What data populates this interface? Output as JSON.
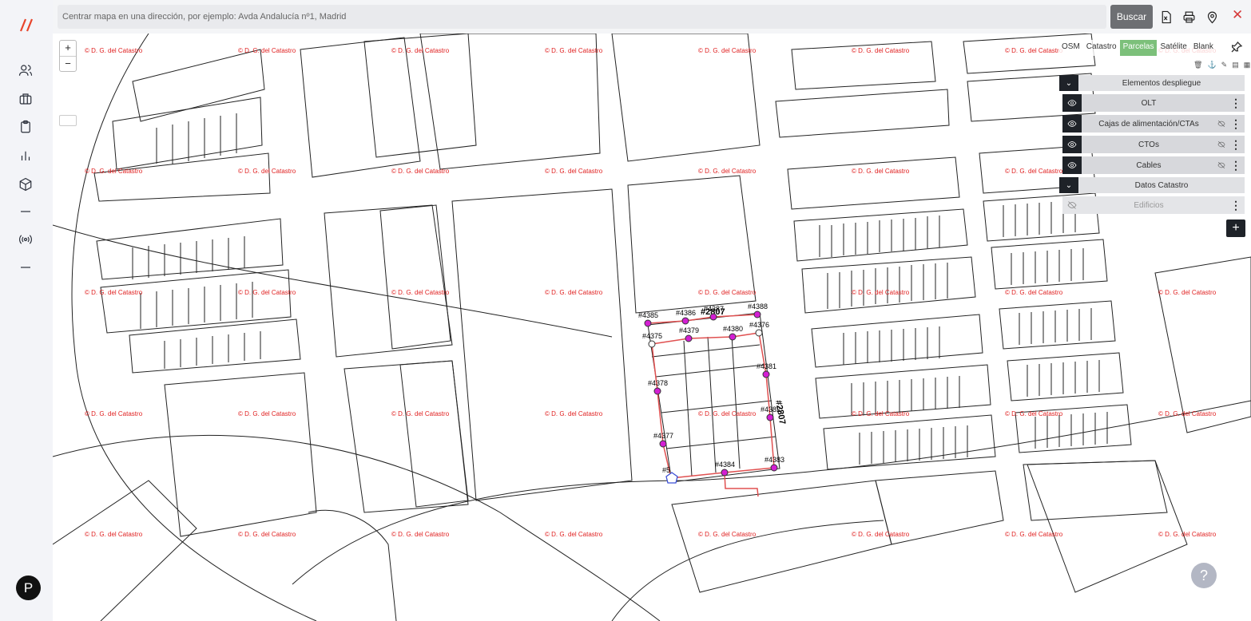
{
  "search": {
    "placeholder": "Centrar mapa en una dirección, por ejemplo: Avda Andalucía nº1, Madrid",
    "button": "Buscar"
  },
  "toolbar": {
    "close": "✕"
  },
  "sidebar": {
    "avatar_initial": "P"
  },
  "map": {
    "zoom_in": "+",
    "zoom_out": "−",
    "watermark": "© D. G. del Catastro",
    "basemaps": [
      "OSM",
      "Catastro",
      "Parcelas",
      "Satélite",
      "Blank"
    ],
    "active_basemap": "Parcelas",
    "nodes": [
      "#4385",
      "#4386",
      "#2807",
      "#4387",
      "#4388",
      "#4375",
      "#4379",
      "#4380",
      "#4376",
      "#4381",
      "#4378",
      "#2807",
      "#4382",
      "#4377",
      "#5",
      "#4384",
      "#4383"
    ],
    "route_color": "#e05050",
    "node_color": "#d31fd3"
  },
  "layers_panel": {
    "group1_title": "Elementos despliegue",
    "layers": [
      "OLT",
      "Cajas de alimentación/CTAs",
      "CTOs",
      "Cables"
    ],
    "group2_title": "Datos Catastro",
    "catastro_layers": [
      "Edificios"
    ]
  },
  "help": "?"
}
